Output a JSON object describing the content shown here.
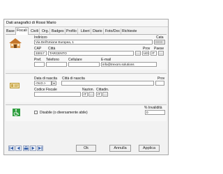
{
  "window": {
    "title": "Dati anagrafici di Rossi Mario"
  },
  "tabs": [
    "Base",
    "Fiscali",
    "Civili",
    "Org.",
    "Badges",
    "Profilo",
    "Liberi",
    "Diario",
    "Foto/Doc",
    "Richieste"
  ],
  "active_tab": "Fiscali",
  "address": {
    "indirizzo_label": "Indirizzo",
    "indirizzo_value": "Via Dell'Unione Europea, 1",
    "cata_label": "Cata",
    "cata_value": "0000",
    "cap_label": "CAP",
    "cap_value": "33017",
    "citta_label": "Città",
    "citta_value": "TARCENTO",
    "lookup_label": "...",
    "prov_label": "Prov",
    "prov_value": "UD",
    "paese_label": "Paese",
    "paese_value": "IT",
    "pref_label": "Pref.",
    "telefono_label": "Telefono",
    "cellulare_label": "Cellulare",
    "email_label": "E-mail",
    "email_value": "info@trexom.solutions"
  },
  "birth": {
    "data_label": "Data di nascita",
    "data_value": "<N.D.>",
    "citta_label": "Città di nascita",
    "prov_label": "Prov",
    "cf_label": "Codice Fiscale",
    "nazion_label": "Nazion.",
    "nazion_value": "IT",
    "cittadin_label": "Cittadin.",
    "cittadin_value": "IT",
    "lookup_label": "..."
  },
  "disability": {
    "checkbox_label": "Disabile (o diversamente abile)",
    "percent_label": "% Invalidità",
    "percent_value": "0"
  },
  "footer": {
    "ok": "Ok",
    "annulla": "Annulla",
    "applica": "Applica"
  },
  "colors": {
    "accent": "#3760a8",
    "house_icon": "#d08a3a",
    "accessibility_icon": "#2e9e3e"
  }
}
